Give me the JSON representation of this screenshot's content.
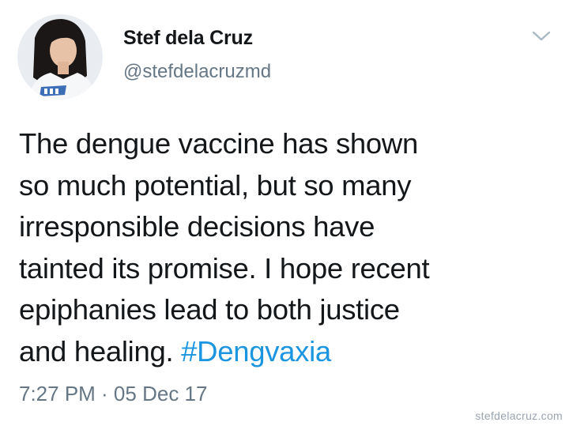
{
  "user": {
    "display_name": "Stef dela Cruz",
    "handle": "@stefdelacruzmd"
  },
  "tweet": {
    "lines": [
      "The dengue vaccine has shown",
      "so much potential, but so many",
      "irresponsible decisions have",
      "tainted its promise. I hope recent",
      "epiphanies lead to both justice"
    ],
    "last_line_text": "and healing. ",
    "hashtag": "#Dengvaxia",
    "timestamp": "7:27 PM · 05 Dec 17"
  },
  "icons": {
    "menu": "chevron-down-icon"
  },
  "watermark": "stefdelacruz.com",
  "colors": {
    "text": "#14171a",
    "secondary": "#657786",
    "link": "#1b95e0",
    "background": "#ffffff"
  }
}
